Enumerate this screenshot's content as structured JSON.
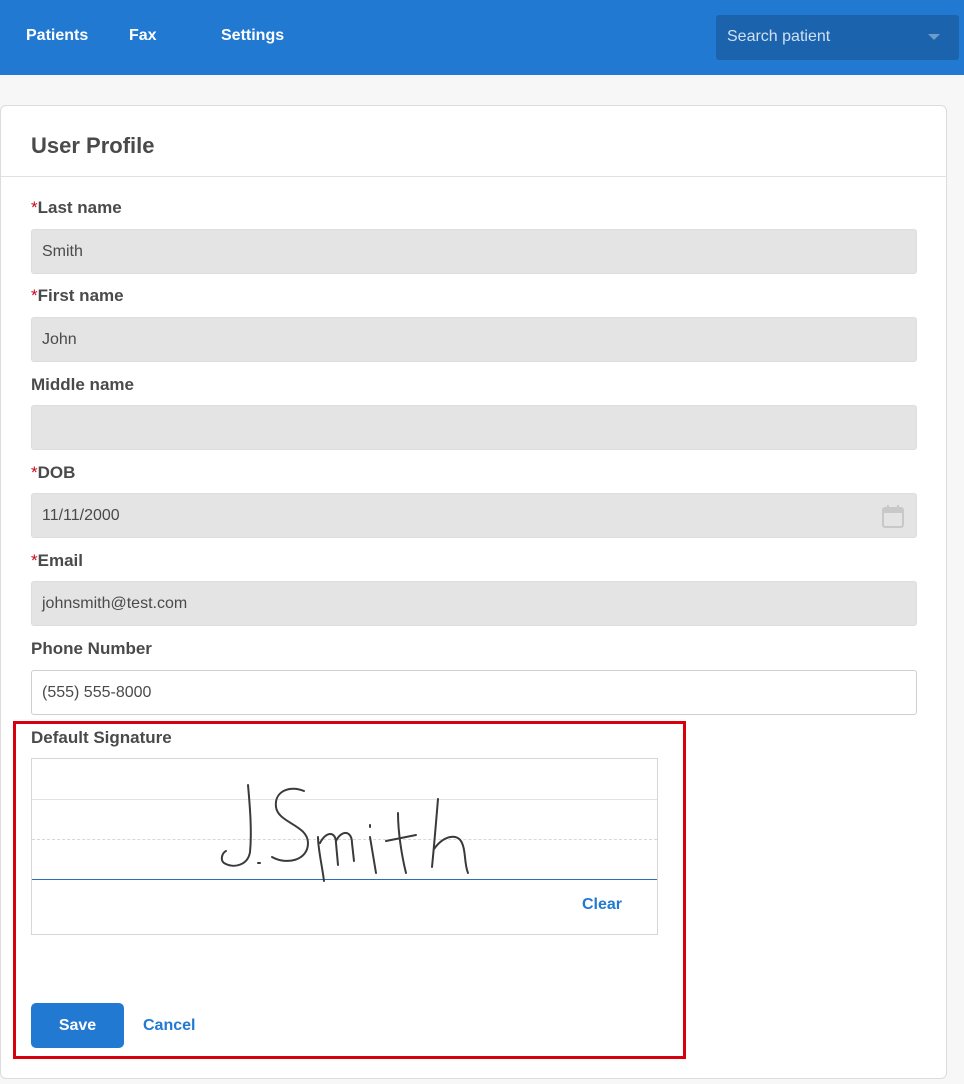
{
  "nav": {
    "links": [
      "Patients",
      "Fax",
      "Settings"
    ],
    "search_placeholder": "Search patient",
    "background": "#2179d2"
  },
  "profile": {
    "title": "User Profile",
    "fields": {
      "last_name": {
        "label": "Last name",
        "required_mark": "*",
        "value": "Smith"
      },
      "first_name": {
        "label": "First name",
        "required_mark": "*",
        "value": "John"
      },
      "middle_name": {
        "label": "Middle name",
        "value": ""
      },
      "dob": {
        "label": "DOB",
        "required_mark": "*",
        "value": "11/11/2000",
        "icon": "calendar-icon"
      },
      "email": {
        "label": "Email",
        "required_mark": "*",
        "value": "johnsmith@test.com"
      },
      "phone": {
        "label": "Phone Number",
        "value": "(555) 555-8000"
      }
    },
    "signature": {
      "label": "Default Signature",
      "clear_label": "Clear"
    },
    "actions": {
      "save_label": "Save",
      "cancel_label": "Cancel"
    }
  },
  "colors": {
    "accent": "#2179d2",
    "required": "#d0021b",
    "highlight": "#d9000d"
  }
}
